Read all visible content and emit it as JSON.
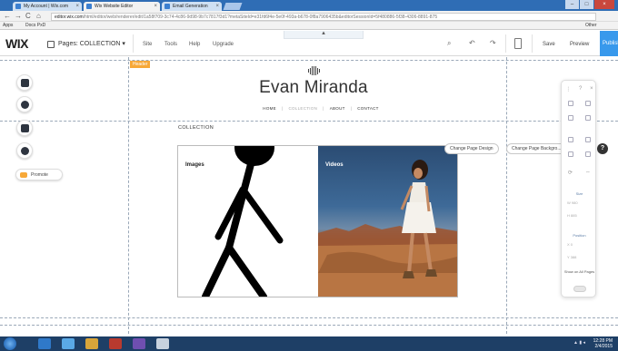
{
  "browser": {
    "tabs": [
      {
        "label": "My Account | Wix.com"
      },
      {
        "label": "Wix Website Editor"
      },
      {
        "label": "Email Generation"
      }
    ],
    "url": "editor.wix.com/html/editor/web/renderer/edit/1a58f709-3c74-4c86-9d98-9b7c7817f3d1?metaSiteId=e31fd6f4e-5e0f-493a-b678-0f8a7906435b&editorSessionId=5f480886-5f38-4306-8891-875",
    "url_domain": "editor.wix.com",
    "bookmarks": [
      {
        "label": "Apps"
      },
      {
        "label": "Docs PxD"
      }
    ],
    "other_bookmarks": "Other bookmarks"
  },
  "wix_bar": {
    "logo": "WIX",
    "pages_dropdown": "Pages: COLLECTION",
    "menu": [
      "Site",
      "Tools",
      "Help",
      "Upgrade"
    ],
    "save": "Save",
    "preview": "Preview",
    "publish": "Publish"
  },
  "canvas": {
    "header_tag": "Header",
    "site_title": "Evan Miranda",
    "nav": [
      "HOME",
      "COLLECTION",
      "ABOUT",
      "CONTACT"
    ],
    "section_label": "COLLECTION",
    "gallery": [
      {
        "caption": "Images"
      },
      {
        "caption": "Videos"
      }
    ],
    "change_design": "Change Page Design",
    "change_background": "Change Page Backgro..."
  },
  "left_rail": {
    "promote": "Promote"
  },
  "inspector": {
    "size_label": "Size",
    "w_label": "W",
    "w_value": "980",
    "h_label": "H",
    "h_value": "885",
    "position_label": "Position",
    "x_label": "X",
    "x_value": "0",
    "y_label": "Y",
    "y_value": "388",
    "show_all": "Show on All Pages"
  },
  "taskbar": {
    "time": "12:28 PM",
    "date": "2/4/2015"
  },
  "colors": {
    "wix_blue": "#3899ec",
    "header_orange": "#f7a838",
    "taskbar": "#1e3f66"
  }
}
